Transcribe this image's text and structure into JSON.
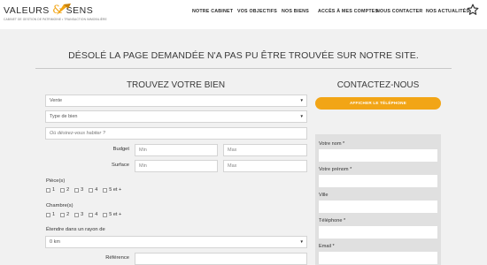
{
  "brand": {
    "name_left": "VALEURS",
    "name_amp": "&",
    "name_right": "SENS",
    "tagline": "CABINET DE GESTION DE PATRIMOINE • TRANSACTION IMMOBILIÈRE",
    "accent_color": "#f2a516"
  },
  "nav": {
    "items": [
      "NOTRE CABINET",
      "VOS OBJECTIFS",
      "NOS BIENS",
      "ACCÈS À MES COMPTES",
      "NOUS CONTACTER",
      "NOS ACTUALITÉS"
    ],
    "favorite_icon": "star-outline-icon"
  },
  "error": {
    "message": "DÉSOLÉ LA PAGE DEMANDÉE N'A PAS PU ÊTRE TROUVÉE SUR NOTRE SITE."
  },
  "search": {
    "title": "TROUVEZ VOTRE BIEN",
    "transaction_value": "Vente",
    "property_type_placeholder": "Type de bien",
    "location_placeholder": "Où désirez-vous habiter ?",
    "budget_label": "Budget",
    "surface_label": "Surface",
    "min_placeholder": "Min",
    "max_placeholder": "Max",
    "rooms_label": "Pièce(s)",
    "bedrooms_label": "Chambre(s)",
    "room_options": [
      "1",
      "2",
      "3",
      "4",
      "5 et +"
    ],
    "radius_label": "Étendre dans un rayon de",
    "radius_value": "0 km",
    "reference_label": "Référence"
  },
  "contact": {
    "title": "CONTACTEZ-NOUS",
    "phone_button": "AFFICHER LE TÉLÉPHONE",
    "fields": [
      "Votre nom *",
      "Votre prénom *",
      "Ville",
      "Téléphone *",
      "Email *"
    ]
  }
}
